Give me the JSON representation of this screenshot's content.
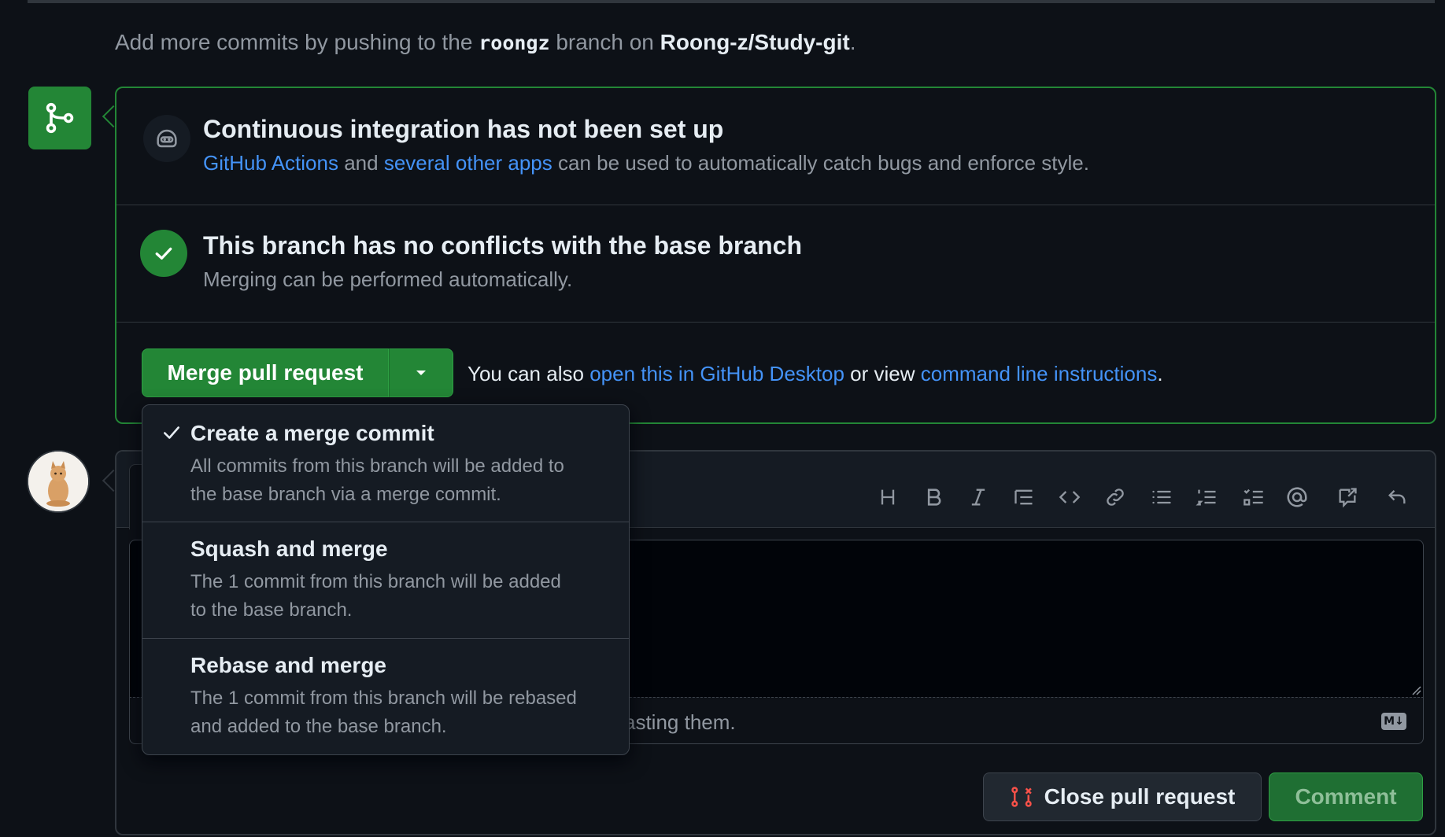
{
  "header": {
    "push_prefix": "Add more commits by pushing to the",
    "branch": "roongz",
    "branch_on": "branch on",
    "repo": "Roong-z/Study-git",
    "period": "."
  },
  "ci": {
    "title": "Continuous integration has not been set up",
    "link1": "GitHub Actions",
    "and": "and",
    "link2": "several other apps",
    "rest": "can be used to automatically catch bugs and enforce style."
  },
  "conflicts": {
    "title": "This branch has no conflicts with the base branch",
    "subtitle": "Merging can be performed automatically."
  },
  "merge": {
    "button_label": "Merge pull request",
    "also_prefix": "You can also",
    "desktop_link": "open this in GitHub Desktop",
    "or_view": "or view",
    "cli_link": "command line instructions",
    "period": "."
  },
  "merge_menu": {
    "items": [
      {
        "title": "Create a merge commit",
        "line1": "All commits from this branch will be added to",
        "line2": "the base branch via a merge commit.",
        "selected": true
      },
      {
        "title": "Squash and merge",
        "line1": "The 1 commit from this branch will be added",
        "line2": "to the base branch.",
        "selected": false
      },
      {
        "title": "Rebase and merge",
        "line1": "The 1 commit from this branch will be rebased",
        "line2": "and added to the base branch.",
        "selected": false
      }
    ]
  },
  "comment": {
    "footer_hint": "asting them.",
    "markdown_badge": "M↓",
    "toolbar_icons": [
      "heading-icon",
      "bold-icon",
      "italic-icon",
      "quote-icon",
      "code-icon",
      "link-icon",
      "unordered-list-icon",
      "ordered-list-icon",
      "task-list-icon",
      "mention-icon",
      "reference-icon",
      "undo-icon"
    ],
    "close_button": "Close pull request",
    "comment_button": "Comment"
  },
  "colors": {
    "background": "#0d1117",
    "success": "#238636",
    "link": "#4493f8",
    "danger": "#f85149"
  }
}
